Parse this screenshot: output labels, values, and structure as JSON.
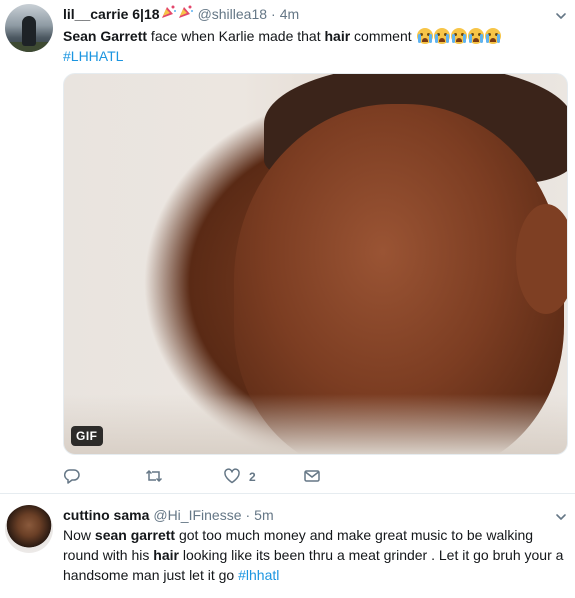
{
  "tweets": [
    {
      "name": "lil__carrie 6|18",
      "handle": "@shillea18",
      "separator": "·",
      "time": "4m",
      "text_parts": {
        "p1": "Sean Garrett",
        "p2": " face when Karlie made  that ",
        "p3": "hair",
        "p4": " comment ",
        "hashtag": "#LHHATL"
      },
      "media_badge": "GIF",
      "actions": {
        "reply_count": "",
        "retweet_count": "",
        "like_count": "2"
      }
    },
    {
      "name": "cuttino sama",
      "handle": "@Hi_IFinesse",
      "separator": "·",
      "time": "5m",
      "text_parts": {
        "p1": "Now ",
        "p2": "sean garrett",
        "p3": " got too much money and make great music to be walking round with his ",
        "p4": "hair",
        "p5": " looking like its been thru a meat grinder . Let it go bruh your a handsome man just let it go ",
        "hashtag": "#lhhatl"
      }
    }
  ],
  "icons": {
    "reply": "reply-icon",
    "retweet": "retweet-icon",
    "like": "heart-icon",
    "dm": "envelope-icon",
    "more": "chevron-down-icon",
    "emoji_name": "party-popper-emoji",
    "emoji_comment": "loudly-crying-face-emoji"
  },
  "colors": {
    "link": "#1b95e0",
    "secondary_text": "#657786",
    "primary_text": "#14171a"
  }
}
